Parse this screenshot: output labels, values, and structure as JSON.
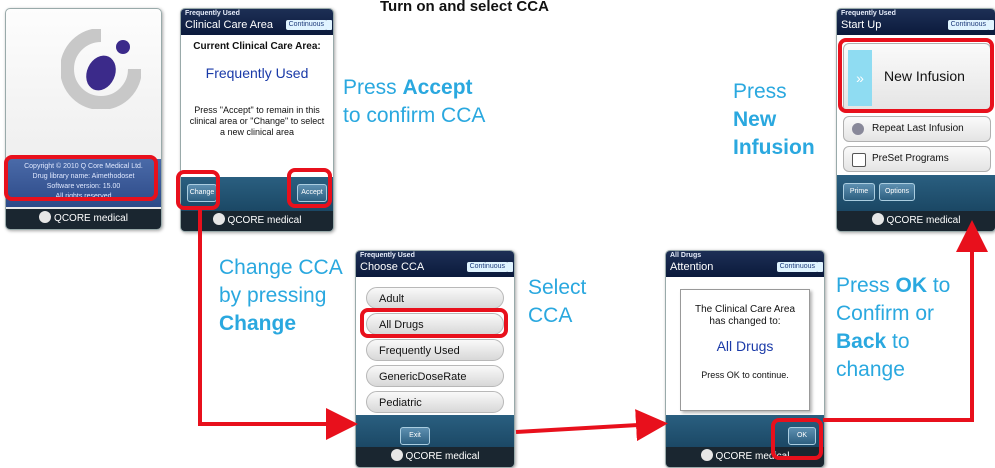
{
  "title": "Turn on and select CCA",
  "splash": {
    "copyright": "Copyright © 2010 Q Core Medical Ltd.",
    "library": "Drug library name: Aimethodoset",
    "software": "Software version: 15.00",
    "rights": "All rights reserved",
    "brand": "QCORE medical"
  },
  "screen_current": {
    "header_small": "Frequently Used",
    "header_title": "Clinical Care Area",
    "mode": "Continuous",
    "heading": "Current Clinical Care Area:",
    "area": "Frequently Used",
    "message": "Press \"Accept\" to remain in this clinical area or \"Change\" to select a new clinical area",
    "change_label": "Change",
    "accept_label": "Accept",
    "brand": "QCORE medical"
  },
  "screen_startup": {
    "header_small": "Frequently Used",
    "header_title": "Start Up",
    "mode": "Continuous",
    "new_infusion": "New Infusion",
    "repeat_last": "Repeat Last Infusion",
    "preset": "PreSet Programs",
    "prime_label": "Prime",
    "options_label": "Options",
    "brand": "QCORE medical"
  },
  "screen_choose": {
    "header_small": "Frequently Used",
    "header_title": "Choose CCA",
    "mode": "Continuous",
    "items": [
      "Adult",
      "All Drugs",
      "Frequently Used",
      "GenericDoseRate",
      "Pediatric"
    ],
    "exit_label": "Exit",
    "brand": "QCORE medical"
  },
  "screen_attention": {
    "header_small": "All Drugs",
    "header_title": "Attention",
    "mode": "Continuous",
    "message1": "The Clinical Care Area has changed to:",
    "area": "All Drugs",
    "message2": "Press OK to continue.",
    "ok_label": "OK",
    "brand": "QCORE medical"
  },
  "notes": {
    "accept": {
      "pre": "Press ",
      "bold": "Accept",
      "post": "to confirm CCA"
    },
    "new_infusion": {
      "line1": "Press",
      "bold": "New Infusion"
    },
    "change": {
      "line1": "Change CCA",
      "line2": "by pressing",
      "bold": "Change"
    },
    "select": {
      "line1": "Select",
      "line2": "CCA"
    },
    "ok": {
      "pre": "Press ",
      "bold1": "OK",
      "post1": " to",
      "line2": "Confirm or",
      "bold2": "Back",
      "post2": " to",
      "line4": "change"
    }
  },
  "colors": {
    "annotation": "#2aa8df",
    "highlight": "#e8101c",
    "header": "#0b1a3c",
    "area_text": "#1a3aa8"
  }
}
